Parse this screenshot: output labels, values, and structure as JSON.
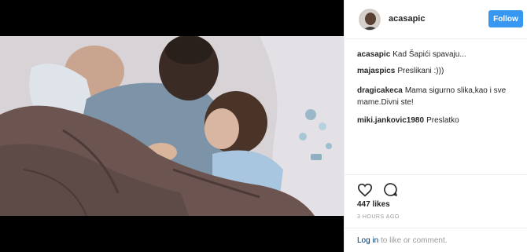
{
  "post": {
    "username": "acasapic",
    "follow_label": "Follow",
    "likes": "447 likes",
    "time": "3 HOURS AGO"
  },
  "comments": [
    {
      "user": "acasapic",
      "text": "Kad Šapići spavaju..."
    },
    {
      "user": "majaspics",
      "text": "Preslikani :)))"
    },
    {
      "user": "dragicakeca",
      "text": "Mama sigurno slika,kao i sve mame.Divni ste!"
    },
    {
      "user": "miki.jankovic1980",
      "text": "Preslatko"
    }
  ],
  "login": {
    "link_label": "Log in",
    "rest_text": " to like or comment."
  },
  "icons": {
    "like": "heart-icon",
    "comment": "comment-icon"
  },
  "colors": {
    "follow_button": "#3897f0",
    "border": "#efefef"
  }
}
